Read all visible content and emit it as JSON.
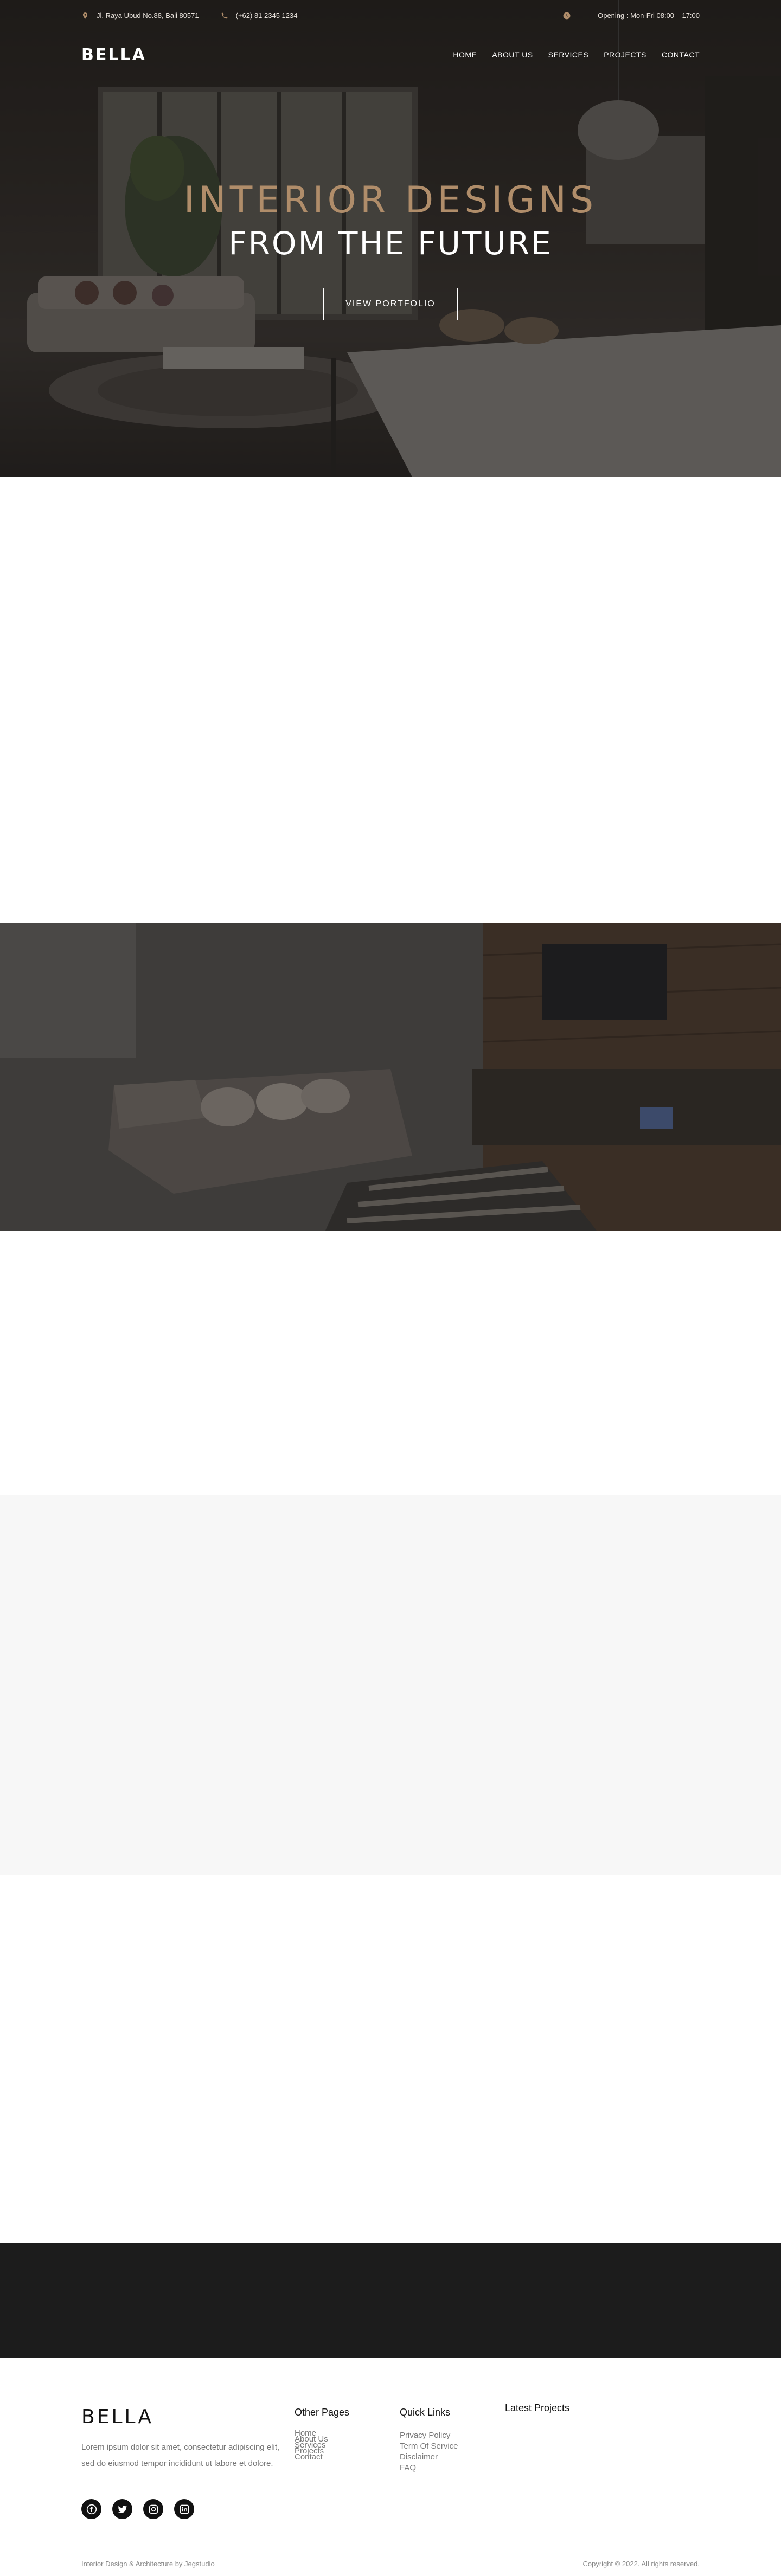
{
  "topbar": {
    "address": "Jl. Raya Ubud No.88, Bali 80571",
    "phone": "(+62) 81 2345 1234",
    "opening": "Opening : Mon-Fri 08:00 – 17:00",
    "icons": [
      "location-icon",
      "phone-icon",
      "clock-icon"
    ],
    "accent_color": "#b08d6a"
  },
  "navbar": {
    "logo": "BELLA",
    "menu": [
      "HOME",
      "ABOUT US",
      "SERVICES",
      "PROJECTS",
      "CONTACT"
    ]
  },
  "hero": {
    "line1": "INTERIOR DESIGNS",
    "line2": "FROM THE FUTURE",
    "button": "VIEW PORTFOLIO",
    "line1_color": "#b08d6a"
  },
  "footer": {
    "logo": "BELLA",
    "description": "Lorem ipsum dolor sit amet, consectetur adipiscing elit, sed do eiusmod tempor incididunt ut labore et dolore.",
    "socials": [
      "facebook-icon",
      "twitter-icon",
      "instagram-icon",
      "linkedin-icon"
    ],
    "other_pages": {
      "title": "Other Pages",
      "links": [
        "Home",
        "About Us",
        "Services",
        "Projects",
        "Contact"
      ]
    },
    "quick_links": {
      "title": "Quick Links",
      "links": [
        "Privacy Policy",
        "Term Of Service",
        "Disclaimer",
        "FAQ"
      ]
    },
    "latest_projects": {
      "title": "Latest Projects"
    },
    "credit": "Interior Design & Architecture by Jegstudio",
    "copyright": "Copyright © 2022. All rights reserved."
  }
}
